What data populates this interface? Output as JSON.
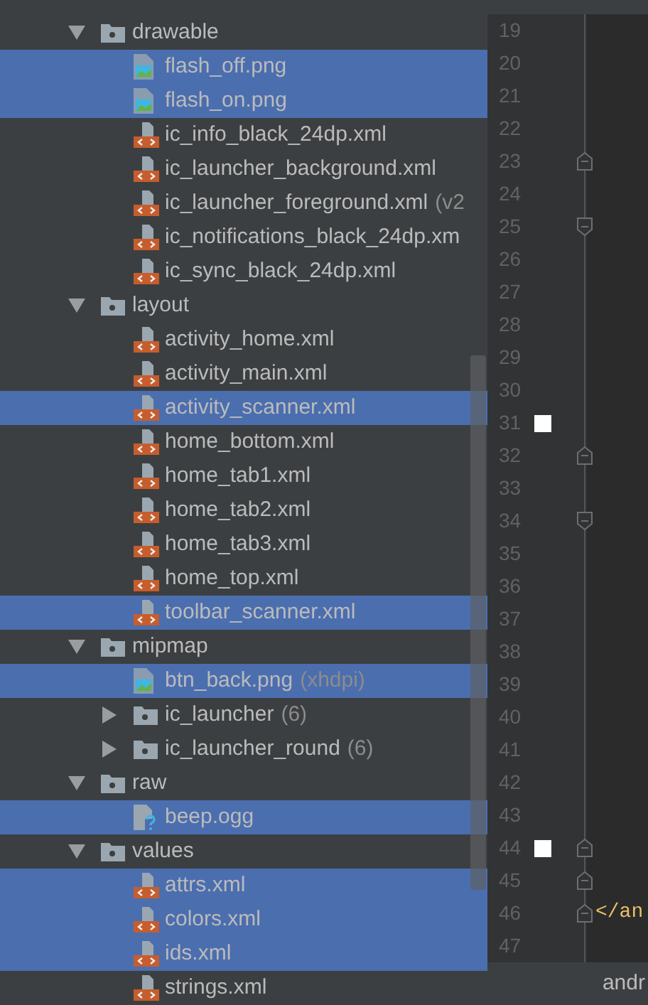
{
  "project_tree": [
    {
      "kind": "folder",
      "label": "drawable",
      "expanded": true,
      "selected": false,
      "children": [
        {
          "kind": "image",
          "label": "flash_off.png",
          "selected": true
        },
        {
          "kind": "image",
          "label": "flash_on.png",
          "selected": true
        },
        {
          "kind": "xml",
          "label": "ic_info_black_24dp.xml",
          "selected": false
        },
        {
          "kind": "xml",
          "label": "ic_launcher_background.xml",
          "selected": false
        },
        {
          "kind": "xml",
          "label": "ic_launcher_foreground.xml",
          "hint": "(v2",
          "selected": false
        },
        {
          "kind": "xml",
          "label": "ic_notifications_black_24dp.xm",
          "selected": false
        },
        {
          "kind": "xml",
          "label": "ic_sync_black_24dp.xml",
          "selected": false
        }
      ]
    },
    {
      "kind": "folder",
      "label": "layout",
      "expanded": true,
      "selected": false,
      "children": [
        {
          "kind": "xml",
          "label": "activity_home.xml",
          "selected": false
        },
        {
          "kind": "xml",
          "label": "activity_main.xml",
          "selected": false
        },
        {
          "kind": "xml",
          "label": "activity_scanner.xml",
          "selected": true
        },
        {
          "kind": "xml",
          "label": "home_bottom.xml",
          "selected": false
        },
        {
          "kind": "xml",
          "label": "home_tab1.xml",
          "selected": false
        },
        {
          "kind": "xml",
          "label": "home_tab2.xml",
          "selected": false
        },
        {
          "kind": "xml",
          "label": "home_tab3.xml",
          "selected": false
        },
        {
          "kind": "xml",
          "label": "home_top.xml",
          "selected": false
        },
        {
          "kind": "xml",
          "label": "toolbar_scanner.xml",
          "selected": true
        }
      ]
    },
    {
      "kind": "folder",
      "label": "mipmap",
      "expanded": true,
      "selected": false,
      "children": [
        {
          "kind": "image",
          "label": "btn_back.png",
          "hint": "(xhdpi)",
          "selected": true
        },
        {
          "kind": "folder",
          "label": "ic_launcher",
          "hint": "(6)",
          "expanded": false,
          "selected": false
        },
        {
          "kind": "folder",
          "label": "ic_launcher_round",
          "hint": "(6)",
          "expanded": false,
          "selected": false
        }
      ]
    },
    {
      "kind": "folder",
      "label": "raw",
      "expanded": true,
      "selected": false,
      "children": [
        {
          "kind": "unknown",
          "label": "beep.ogg",
          "selected": true
        }
      ]
    },
    {
      "kind": "folder",
      "label": "values",
      "expanded": true,
      "selected": false,
      "children": [
        {
          "kind": "xml",
          "label": "attrs.xml",
          "selected": true
        },
        {
          "kind": "xml",
          "label": "colors.xml",
          "selected": true
        },
        {
          "kind": "xml",
          "label": "ids.xml",
          "selected": true
        },
        {
          "kind": "xml",
          "label": "strings.xml",
          "selected": false
        }
      ]
    }
  ],
  "editor": {
    "lines": [
      {
        "number": "19",
        "bookmark": false,
        "kind": "plain"
      },
      {
        "number": "20",
        "bookmark": false,
        "kind": "plain"
      },
      {
        "number": "21",
        "bookmark": false,
        "kind": "plain"
      },
      {
        "number": "22",
        "bookmark": false,
        "kind": "plain"
      },
      {
        "number": "23",
        "bookmark": false,
        "kind": "fold-up"
      },
      {
        "number": "24",
        "bookmark": false,
        "kind": "plain"
      },
      {
        "number": "25",
        "bookmark": false,
        "kind": "fold-down"
      },
      {
        "number": "26",
        "bookmark": false,
        "kind": "plain"
      },
      {
        "number": "27",
        "bookmark": false,
        "kind": "plain"
      },
      {
        "number": "28",
        "bookmark": false,
        "kind": "plain"
      },
      {
        "number": "29",
        "bookmark": false,
        "kind": "plain"
      },
      {
        "number": "30",
        "bookmark": false,
        "kind": "plain"
      },
      {
        "number": "31",
        "bookmark": true,
        "kind": "plain"
      },
      {
        "number": "32",
        "bookmark": false,
        "kind": "fold-up"
      },
      {
        "number": "33",
        "bookmark": false,
        "kind": "plain"
      },
      {
        "number": "34",
        "bookmark": false,
        "kind": "fold-down"
      },
      {
        "number": "35",
        "bookmark": false,
        "kind": "plain"
      },
      {
        "number": "36",
        "bookmark": false,
        "kind": "plain"
      },
      {
        "number": "37",
        "bookmark": false,
        "kind": "plain"
      },
      {
        "number": "38",
        "bookmark": false,
        "kind": "plain"
      },
      {
        "number": "39",
        "bookmark": false,
        "kind": "plain"
      },
      {
        "number": "40",
        "bookmark": false,
        "kind": "plain"
      },
      {
        "number": "41",
        "bookmark": false,
        "kind": "plain"
      },
      {
        "number": "42",
        "bookmark": false,
        "kind": "plain"
      },
      {
        "number": "43",
        "bookmark": false,
        "kind": "plain"
      },
      {
        "number": "44",
        "bookmark": true,
        "kind": "fold-up"
      },
      {
        "number": "45",
        "bookmark": false,
        "kind": "fold-up"
      },
      {
        "number": "46",
        "bookmark": false,
        "kind": "fold-up",
        "code": "</an"
      },
      {
        "number": "47",
        "bookmark": false,
        "kind": "plain"
      }
    ],
    "breadcrumb": "andr"
  }
}
